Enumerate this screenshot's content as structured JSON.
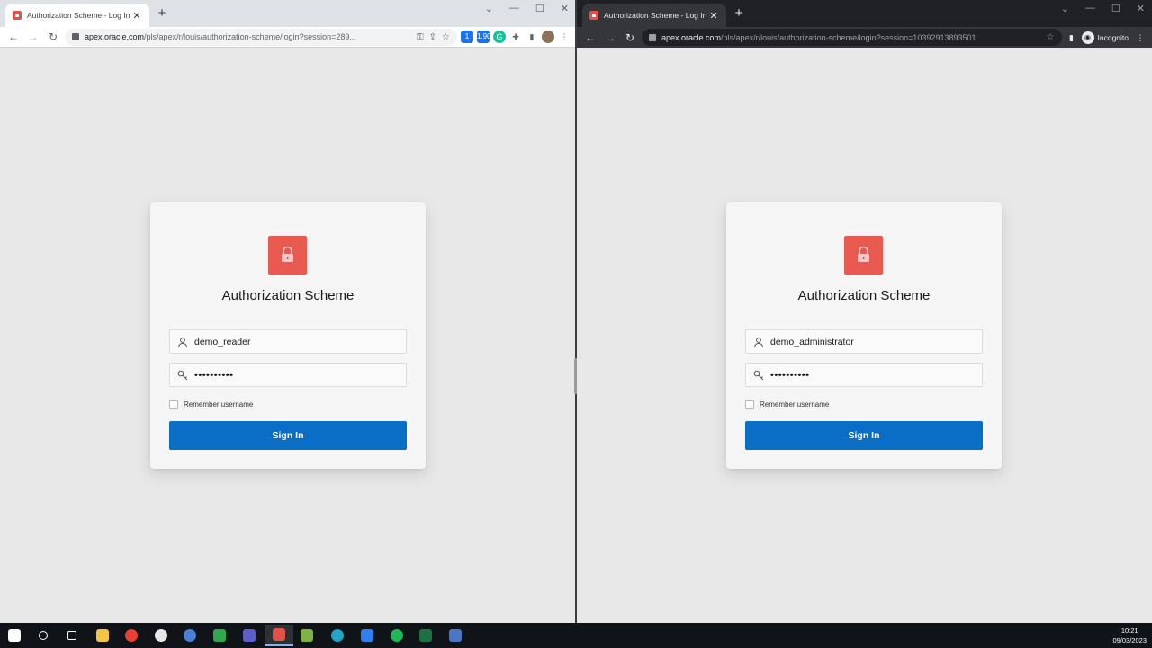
{
  "left_window": {
    "tab_title": "Authorization Scheme - Log In",
    "url_host": "apex.oracle.com",
    "url_path": "/pls/apex/r/louis/authorization-scheme/login?session=289...",
    "ext_badge_1": "1",
    "ext_badge_2": "1.90",
    "login": {
      "title": "Authorization Scheme",
      "username": "demo_reader",
      "password_mask": "••••••••••",
      "remember_label": "Remember username",
      "sign_in_label": "Sign In"
    }
  },
  "right_window": {
    "tab_title": "Authorization Scheme - Log In",
    "url_host": "apex.oracle.com",
    "url_path": "/pls/apex/r/louis/authorization-scheme/login?session=10392913893501",
    "incognito_label": "Incognito",
    "login": {
      "title": "Authorization Scheme",
      "username": "demo_administrator",
      "password_mask": "••••••••••",
      "remember_label": "Remember username",
      "sign_in_label": "Sign In"
    }
  },
  "taskbar": {
    "time": "10:21",
    "date": "09/03/2023",
    "apps": [
      {
        "name": "start-icon",
        "color": "#ffffff"
      },
      {
        "name": "search-icon",
        "color": "#ffffff"
      },
      {
        "name": "task-view-icon",
        "color": "#ffffff"
      },
      {
        "name": "file-explorer-icon",
        "color": "#f4c542"
      },
      {
        "name": "chrome-icon",
        "color": "#e94235"
      },
      {
        "name": "slack-icon",
        "color": "#e8e8e8"
      },
      {
        "name": "firefox-icon",
        "color": "#4a7fd8"
      },
      {
        "name": "video-editor-icon",
        "color": "#2fa84f"
      },
      {
        "name": "teams-icon",
        "color": "#5b5fc7"
      },
      {
        "name": "active-window-icon",
        "color": "#e0534a"
      },
      {
        "name": "notepad-icon",
        "color": "#7cb342"
      },
      {
        "name": "edge-icon",
        "color": "#1fa6c9"
      },
      {
        "name": "vscode-icon",
        "color": "#2f80ed"
      },
      {
        "name": "spotify-icon",
        "color": "#1db954"
      },
      {
        "name": "excel-icon",
        "color": "#1e7145"
      },
      {
        "name": "calculator-icon",
        "color": "#4a76c8"
      }
    ]
  },
  "colors": {
    "accent_button": "#0a6ec6",
    "lock_icon_bg": "#e8594f",
    "page_bg": "#e8e8e8"
  }
}
